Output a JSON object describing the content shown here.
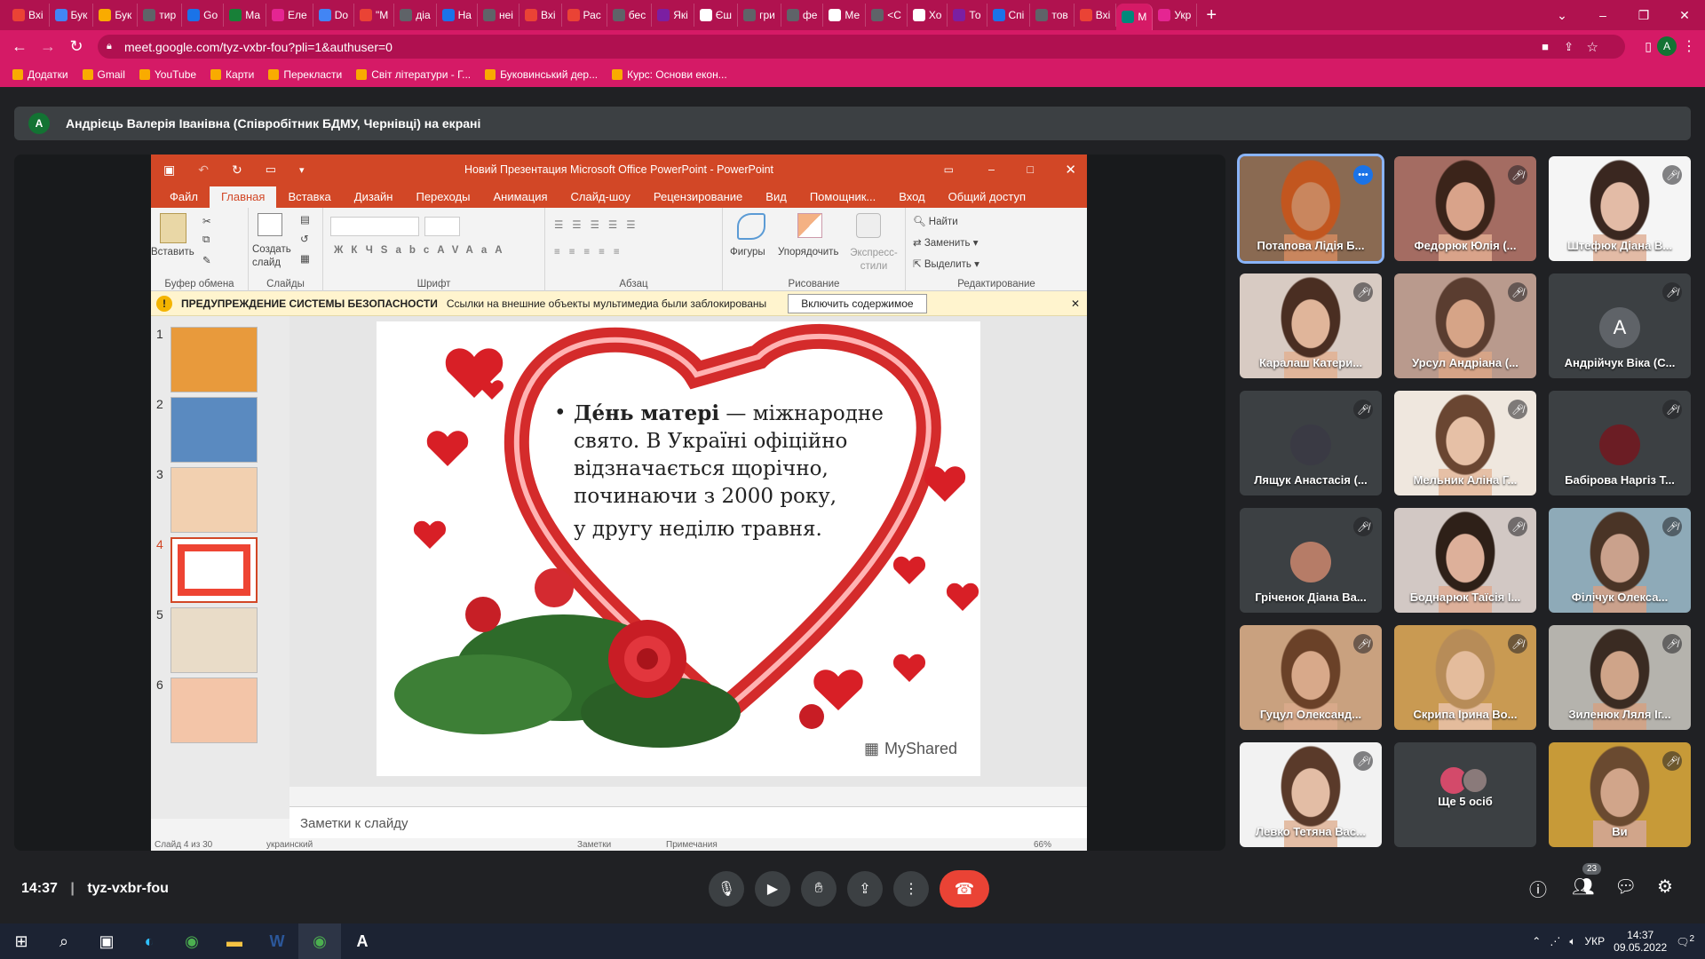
{
  "browser": {
    "tabs": [
      {
        "label": "Вхі",
        "color": "#ea4335"
      },
      {
        "label": "Бук",
        "color": "#4285f4"
      },
      {
        "label": "Бук",
        "color": "#f9ab00"
      },
      {
        "label": "тир",
        "color": "#5f6368"
      },
      {
        "label": "Go",
        "color": "#1a73e8"
      },
      {
        "label": "Ма",
        "color": "#188038"
      },
      {
        "label": "Еле",
        "color": "#e52592"
      },
      {
        "label": "Do",
        "color": "#4285f4"
      },
      {
        "label": "\"М",
        "color": "#ea4335"
      },
      {
        "label": "діа",
        "color": "#5f6368"
      },
      {
        "label": "На",
        "color": "#1a73e8"
      },
      {
        "label": "неі",
        "color": "#5f6368"
      },
      {
        "label": "Вхі",
        "color": "#ea4335"
      },
      {
        "label": "Рас",
        "color": "#ea4335"
      },
      {
        "label": "бес",
        "color": "#5f6368"
      },
      {
        "label": "Які",
        "color": "#7b1fa2"
      },
      {
        "label": "Єш",
        "color": "#ffffff"
      },
      {
        "label": "гри",
        "color": "#5f6368"
      },
      {
        "label": "фе",
        "color": "#5f6368"
      },
      {
        "label": "Ме",
        "color": "#ffffff"
      },
      {
        "label": "<С",
        "color": "#5f6368"
      },
      {
        "label": "Хо",
        "color": "#ffffff"
      },
      {
        "label": "То",
        "color": "#7b1fa2"
      },
      {
        "label": "Спі",
        "color": "#1a73e8"
      },
      {
        "label": "тов",
        "color": "#5f6368"
      },
      {
        "label": "Вхі",
        "color": "#ea4335"
      },
      {
        "label": "М",
        "color": "#00897b"
      },
      {
        "label": "Укр",
        "color": "#e52592"
      }
    ],
    "active_tab_index": 26,
    "url": "meet.google.com/tyz-vxbr-fou?pli=1&authuser=0",
    "profile_initial": "A",
    "bookmarks": [
      "Додатки",
      "Gmail",
      "YouTube",
      "Карти",
      "Перекласти",
      "Світ літератури - Г...",
      "Буковинський дер...",
      "Курс: Основи екон..."
    ]
  },
  "meet": {
    "presenter_initial": "A",
    "presenter_banner": "Андрієць Валерія Іванівна (Співробітник БДМУ, Чернівці) на екрані",
    "time": "14:37",
    "meeting_code": "tyz-vxbr-fou",
    "people_count": "23",
    "participants": [
      {
        "name": "Потапова Лідія Б...",
        "skin": "#c9865e",
        "bg": "#8a6a52",
        "hair": "#c2561f",
        "pinned": true
      },
      {
        "name": "Федорюк Юлія (...",
        "skin": "#d9a38a",
        "bg": "#a46c62",
        "hair": "#3b241a"
      },
      {
        "name": "Штефюк Діана В...",
        "skin": "#e3bba6",
        "bg": "#f5f5f5",
        "hair": "#3a2720"
      },
      {
        "name": "Каралаш Катери...",
        "skin": "#e0b59a",
        "bg": "#d8cbc3",
        "hair": "#4a2e22"
      },
      {
        "name": "Урсул Андріана (...",
        "skin": "#d6a487",
        "bg": "#b99a8d",
        "hair": "#5a3d30"
      },
      {
        "name": "Андрійчук Віка (С...",
        "avatar": "A",
        "avatar_color": "#5f6368"
      },
      {
        "name": "Лящук Анастасія (...",
        "avatar_photo": "#3a3a44"
      },
      {
        "name": "Мельник Аліна Г...",
        "skin": "#e6c0a6",
        "bg": "#efe7de",
        "hair": "#6a4632"
      },
      {
        "name": "Бабірова Наргіз Т...",
        "avatar_photo": "#6b1d24"
      },
      {
        "name": "Гріченок Діана Ва...",
        "avatar_photo": "#b67c67"
      },
      {
        "name": "Боднарюк Таїсія І...",
        "skin": "#ddb09a",
        "bg": "#d2c8c4",
        "hair": "#2e2018"
      },
      {
        "name": "Філічук Олекса...",
        "skin": "#caa18c",
        "bg": "#8eaab8",
        "hair": "#4a3426"
      },
      {
        "name": "Гуцул Олександ...",
        "skin": "#d8a98a",
        "bg": "#c9a17f",
        "hair": "#6a4128"
      },
      {
        "name": "Скрипа Ірина Во...",
        "skin": "#e4bc9c",
        "bg": "#c99a52",
        "hair": "#b78c58"
      },
      {
        "name": "Зиленюк Ляля Іг...",
        "skin": "#cfa489",
        "bg": "#b5b3ad",
        "hair": "#3a2b22"
      },
      {
        "name": "Левко Тетяна Вас...",
        "skin": "#e3bda5",
        "bg": "#f2f2f2",
        "hair": "#5a3a2a"
      },
      {
        "name": "Ще 5 осіб",
        "more": true
      },
      {
        "name": "Ви",
        "skin": "#d1a58a",
        "bg": "#c79a38",
        "hair": "#6a4a30"
      }
    ]
  },
  "ppt": {
    "window_title": "Новий Презентация Microsoft Office PowerPoint - PowerPoint",
    "menu": [
      "Файл",
      "Главная",
      "Вставка",
      "Дизайн",
      "Переходы",
      "Анимация",
      "Слайд-шоу",
      "Рецензирование",
      "Вид",
      "Помощник...",
      "Вход",
      "Общий доступ"
    ],
    "ribbon": {
      "paste": "Вставить",
      "new_slide": "Создать слайд",
      "find": "Найти",
      "replace": "Заменить",
      "select": "Выделить",
      "shapes": "Фигуры",
      "arrange": "Упорядочить",
      "quick_styles": "Экспресс-стили",
      "groups": [
        "Буфер обмена",
        "Слайды",
        "Шрифт",
        "Абзац",
        "Рисование",
        "Редактирование"
      ]
    },
    "security": {
      "title": "ПРЕДУПРЕЖДЕНИЕ СИСТЕМЫ БЕЗОПАСНОСТИ",
      "message": "Ссылки на внешние объекты мультимедиа были заблокированы",
      "button": "Включить содержимое"
    },
    "thumbnails": [
      "1",
      "2",
      "3",
      "4",
      "5",
      "6"
    ],
    "selected_slide": 4,
    "slide_text": {
      "bold": "Де́нь матері",
      "rest": " — міжнародне свято. В Україні офіційно відзначається щорічно, починаючи з 2000 року,",
      "line2": "у другу неділю травня."
    },
    "watermark": "MyShared",
    "notes_placeholder": "Заметки к слайду",
    "status": {
      "slide": "Слайд 4 из 30",
      "lang": "украинский",
      "notes": "Заметки",
      "comments": "Примечания",
      "zoom": "66%"
    }
  },
  "taskbar": {
    "lang": "УКР",
    "time": "14:37",
    "date": "09.05.2022",
    "notifications": "2"
  }
}
